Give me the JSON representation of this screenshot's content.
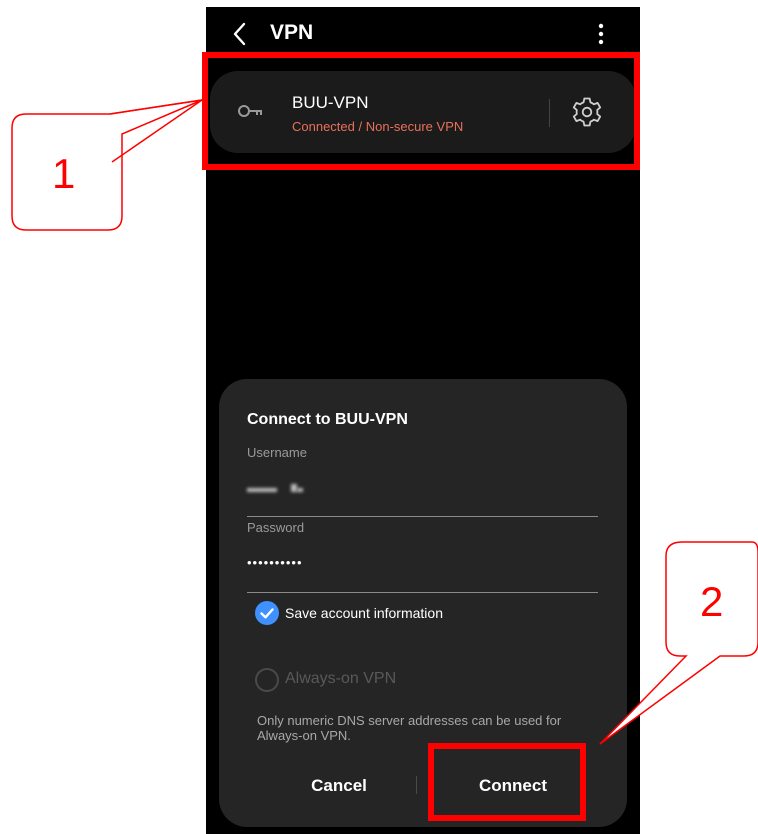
{
  "topbar": {
    "title": "VPN",
    "back_icon": "chevron-left-icon",
    "more_icon": "more-vertical-icon"
  },
  "vpn_profile": {
    "name": "BUU-VPN",
    "status": "Connected / Non-secure VPN",
    "status_color": "#e8705a",
    "icon": "key-icon",
    "settings_icon": "gear-icon"
  },
  "dialog": {
    "title": "Connect to BUU-VPN",
    "username_label": "Username",
    "password_label": "Password",
    "password_value": "••••••••••",
    "save_label": "Save account information",
    "save_checked": true,
    "always_on_label": "Always-on VPN",
    "always_on_checked": false,
    "dns_note": "Only numeric DNS server addresses can be used for Always-on VPN.",
    "cancel_label": "Cancel",
    "connect_label": "Connect",
    "accent_color": "#3e91ff"
  },
  "annotations": {
    "callout_1": "1",
    "callout_2": "2",
    "color": "#ff0000"
  }
}
